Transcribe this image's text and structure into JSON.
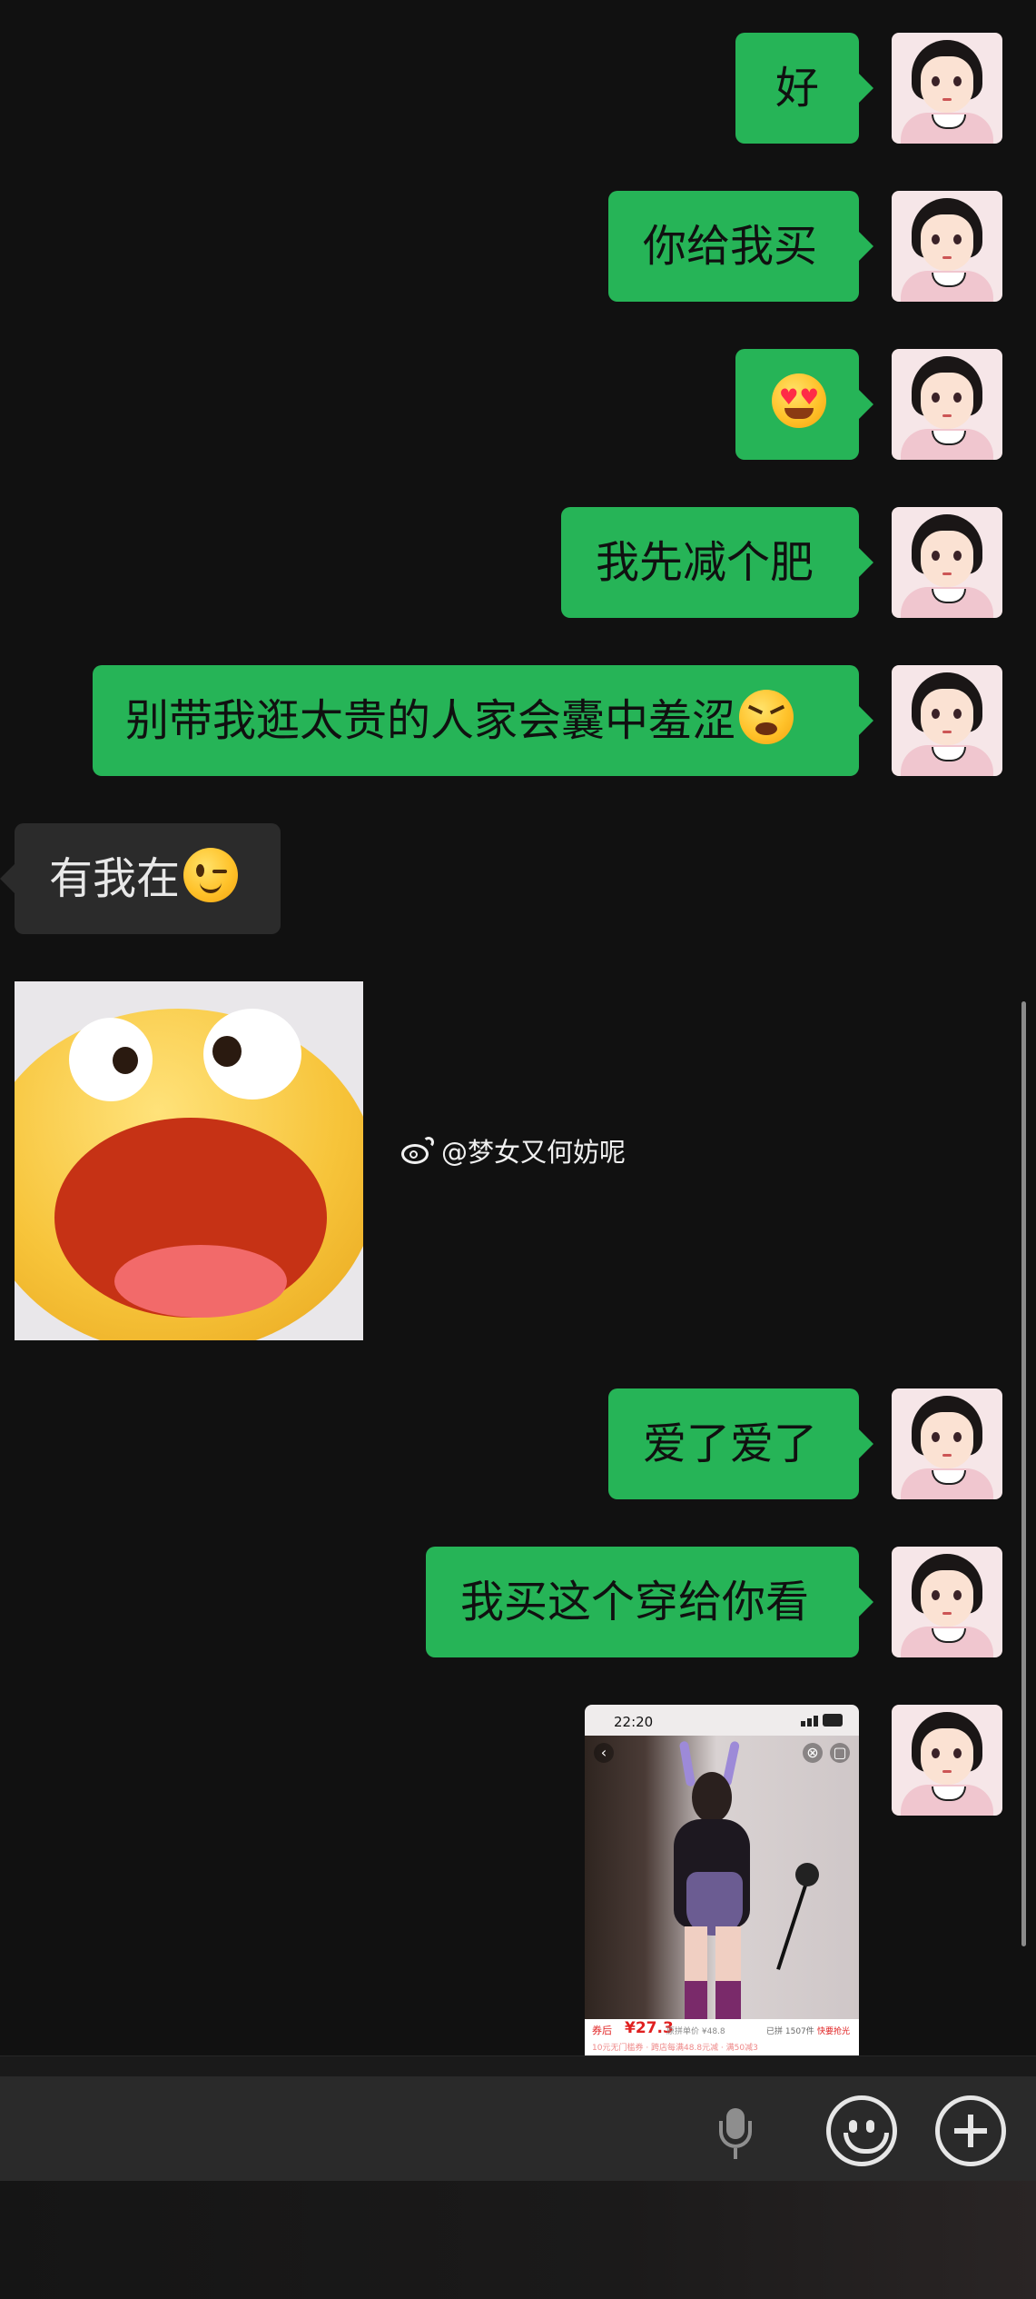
{
  "messages": [
    {
      "side": "out",
      "text": "好"
    },
    {
      "side": "out",
      "text": "你给我买"
    },
    {
      "side": "out",
      "text": "",
      "emoji": "heart-eyes-drool-emoji"
    },
    {
      "side": "out",
      "text": "我先减个肥"
    },
    {
      "side": "out",
      "text": "别带我逛太贵的人家会囊中羞涩",
      "emoji": "tired-face-emoji"
    },
    {
      "side": "in",
      "text": "有我在",
      "emoji": "wink-emoji"
    },
    {
      "side": "in",
      "type": "sticker",
      "sticker": "screaming-laugh-sticker"
    },
    {
      "side": "out",
      "text": "爱了爱了"
    },
    {
      "side": "out",
      "text": "我买这个穿给你看"
    },
    {
      "side": "out",
      "type": "image",
      "image": {
        "status_time": "22:20",
        "price_tag": "券后",
        "price": "¥27.3",
        "original_price": "原拼单价 ¥48.8",
        "sold": "已拼 1507件",
        "promo": "快要抢光",
        "coupon": "10元无门槛券 · 跨店每满48.8元减 · 满50减3"
      }
    }
  ],
  "watermark": {
    "text": "@梦女又何妨呢",
    "icon": "weibo-icon"
  },
  "input_bar": {
    "voice_icon": "microphone-icon",
    "emoji_icon": "smiley-icon",
    "more_icon": "plus-circle-icon"
  },
  "colors": {
    "background": "#111111",
    "outgoing_bubble": "#26b457",
    "incoming_bubble": "#2b2b2b"
  }
}
